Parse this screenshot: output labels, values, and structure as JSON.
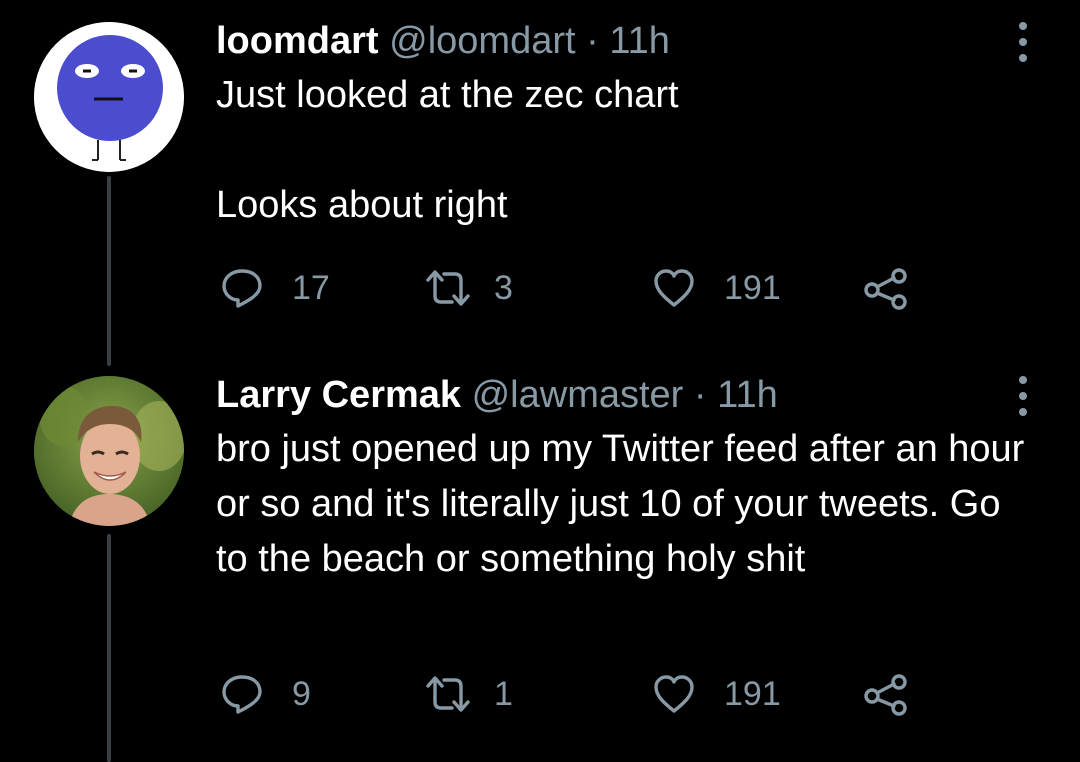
{
  "colors": {
    "background": "#000000",
    "text": "#ffffff",
    "muted": "#8899a6",
    "thread_line": "#3a3f44",
    "avatar_blue": "#4c4ccf"
  },
  "tweets": [
    {
      "name": "loomdart",
      "handle": "@loomdart",
      "separator": "·",
      "time": "11h",
      "text": "Just looked at the zec chart\n\nLooks about right",
      "avatar_icon": "blue-blob-avatar",
      "replies": "17",
      "retweets": "3",
      "likes": "191"
    },
    {
      "name": "Larry Cermak",
      "handle": "@lawmaster",
      "separator": "·",
      "time": "11h",
      "text": "bro just opened up my Twitter feed after an hour or so and it's literally just 10 of your tweets. Go to the beach or something holy shit",
      "avatar_icon": "photo-avatar",
      "replies": "9",
      "retweets": "1",
      "likes": "191"
    }
  ],
  "icons": {
    "reply": "reply-icon",
    "retweet": "retweet-icon",
    "like": "heart-icon",
    "share": "share-icon",
    "more": "more-icon"
  }
}
